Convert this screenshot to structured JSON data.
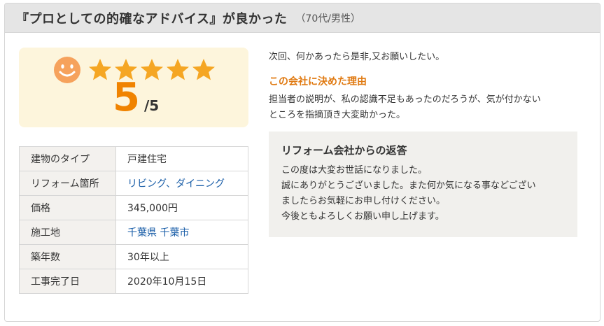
{
  "header": {
    "title": "『プロとしての的確なアドバイス』が良かった",
    "subtitle": "（70代/男性）"
  },
  "rating": {
    "score": "5",
    "max": "/5",
    "stars_filled": 5,
    "star_color": "#f5a623",
    "accent_color": "#f08300",
    "smiley_icon": "smiley-face-icon"
  },
  "details": [
    {
      "label": "建物のタイプ",
      "value": "戸建住宅",
      "link": false
    },
    {
      "label": "リフォーム箇所",
      "value": "リビング、ダイニング",
      "link": true
    },
    {
      "label": "価格",
      "value": "345,000円",
      "link": false
    },
    {
      "label": "施工地",
      "value": "千葉県 千葉市",
      "link": true
    },
    {
      "label": "築年数",
      "value": "30年以上",
      "link": false
    },
    {
      "label": "工事完了日",
      "value": "2020年10月15日",
      "link": false
    }
  ],
  "review": {
    "comment": "次回、何かあったら是非,又お願いしたい。",
    "reason_title": "この会社に決めた理由",
    "reason_lines": [
      "担当者の説明が、私の認識不足もあったのだろうが、気が付かない",
      "ところを指摘頂き大変助かった。"
    ]
  },
  "company_reply": {
    "title": "リフォーム会社からの返答",
    "lines": [
      "この度は大変お世話になりました。",
      "誠にありがとうございました。また何か気になる事などござい",
      "ましたらお気軽にお申し付けください。",
      "今後ともよろしくお願い申し上げます。"
    ]
  }
}
